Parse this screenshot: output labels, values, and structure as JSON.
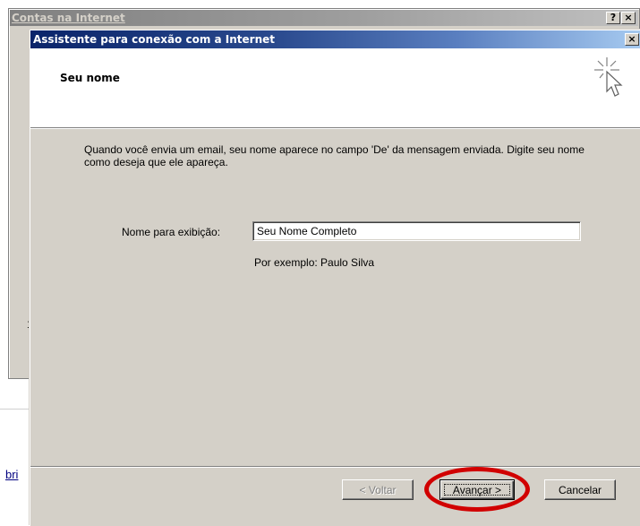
{
  "background_window": {
    "title": "Contas na Internet",
    "help_label": "?",
    "close_label": "×",
    "stub_text": "1",
    "link_text": "bri"
  },
  "dialog": {
    "title": "Assistente para conexão com a Internet",
    "close_label": "×",
    "header_title": "Seu nome",
    "header_icon": "wizard-sparkle-cursor-icon",
    "description": "Quando você envia um email, seu nome aparece no campo 'De' da mensagem enviada. Digite seu nome como deseja que ele apareça.",
    "display_name_label": "Nome para exibição:",
    "display_name_value": "Seu Nome Completo",
    "example_text": "Por exemplo: Paulo Silva",
    "buttons": {
      "back": "< Voltar",
      "next": "Avançar >",
      "cancel": "Cancelar"
    },
    "highlight_color": "#d10000"
  }
}
